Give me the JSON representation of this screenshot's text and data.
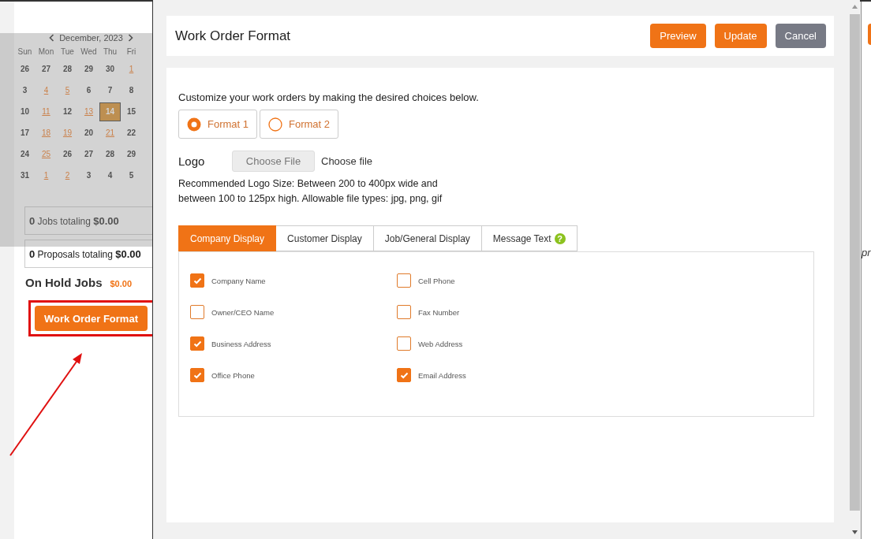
{
  "background_page": {
    "calendar": {
      "month": "December, 2023",
      "weekdays": [
        "Sun",
        "Mon",
        "Tue",
        "Wed",
        "Thu",
        "Fri"
      ],
      "weeks": [
        [
          {
            "day": "26",
            "event": false,
            "selected": false
          },
          {
            "day": "27",
            "event": false,
            "selected": false
          },
          {
            "day": "28",
            "event": false,
            "selected": false
          },
          {
            "day": "29",
            "event": false,
            "selected": false
          },
          {
            "day": "30",
            "event": false,
            "selected": false
          },
          {
            "day": "1",
            "event": true,
            "selected": false
          }
        ],
        [
          {
            "day": "3",
            "event": false,
            "selected": false
          },
          {
            "day": "4",
            "event": true,
            "selected": false
          },
          {
            "day": "5",
            "event": true,
            "selected": false
          },
          {
            "day": "6",
            "event": false,
            "selected": false
          },
          {
            "day": "7",
            "event": false,
            "selected": false
          },
          {
            "day": "8",
            "event": false,
            "selected": false
          }
        ],
        [
          {
            "day": "10",
            "event": false,
            "selected": false
          },
          {
            "day": "11",
            "event": true,
            "selected": false
          },
          {
            "day": "12",
            "event": false,
            "selected": false
          },
          {
            "day": "13",
            "event": true,
            "selected": false
          },
          {
            "day": "14",
            "event": false,
            "selected": true
          },
          {
            "day": "15",
            "event": false,
            "selected": false
          }
        ],
        [
          {
            "day": "17",
            "event": false,
            "selected": false
          },
          {
            "day": "18",
            "event": true,
            "selected": false
          },
          {
            "day": "19",
            "event": true,
            "selected": false
          },
          {
            "day": "20",
            "event": false,
            "selected": false
          },
          {
            "day": "21",
            "event": true,
            "selected": false
          },
          {
            "day": "22",
            "event": false,
            "selected": false
          }
        ],
        [
          {
            "day": "24",
            "event": false,
            "selected": false
          },
          {
            "day": "25",
            "event": true,
            "selected": false
          },
          {
            "day": "26",
            "event": false,
            "selected": false
          },
          {
            "day": "27",
            "event": false,
            "selected": false
          },
          {
            "day": "28",
            "event": false,
            "selected": false
          },
          {
            "day": "29",
            "event": false,
            "selected": false
          }
        ],
        [
          {
            "day": "31",
            "event": false,
            "selected": false
          },
          {
            "day": "1",
            "event": true,
            "selected": false
          },
          {
            "day": "2",
            "event": true,
            "selected": false
          },
          {
            "day": "3",
            "event": false,
            "selected": false
          },
          {
            "day": "4",
            "event": false,
            "selected": false
          },
          {
            "day": "5",
            "event": false,
            "selected": false
          }
        ]
      ]
    },
    "summaries": [
      "**0** Jobs totaling **$0.00**",
      "**0** Proposals totaling **$0.00**"
    ],
    "on_hold": {
      "label": "On Hold Jobs",
      "amount": "$0.00"
    },
    "work_order_button": "Work Order Format",
    "right_edge_text": "pr"
  },
  "modal": {
    "title": "Work Order Format",
    "buttons": [
      {
        "label": "Preview",
        "kind": "primary"
      },
      {
        "label": "Update",
        "kind": "primary"
      },
      {
        "label": "Cancel",
        "kind": "secondary"
      }
    ],
    "intro": "Customize your work orders by making the desired choices below.",
    "formats": [
      {
        "label": "Format 1",
        "selected": true
      },
      {
        "label": "Format 2",
        "selected": false
      }
    ],
    "logo": {
      "label": "Logo",
      "button": "Choose File",
      "status": "Choose file"
    },
    "note": "Recommended Logo Size: Between 200 to 400px wide and between 100 to 125px high. Allowable file types: jpg, png, gif",
    "tabs": [
      {
        "label": "Company Display",
        "selected": true
      },
      {
        "label": "Customer Display",
        "selected": false
      },
      {
        "label": "Job/General Display",
        "selected": false
      },
      {
        "label": "Message Text",
        "selected": false,
        "help": "?"
      }
    ],
    "fields": [
      {
        "label": "Company Name",
        "checked": true
      },
      {
        "label": "Cell Phone",
        "checked": false
      },
      {
        "label": "Owner/CEO Name",
        "checked": false
      },
      {
        "label": "Fax Number",
        "checked": false
      },
      {
        "label": "Business Address",
        "checked": true
      },
      {
        "label": "Web Address",
        "checked": false
      },
      {
        "label": "Office Phone",
        "checked": true
      },
      {
        "label": "Email Address",
        "checked": true
      }
    ]
  }
}
